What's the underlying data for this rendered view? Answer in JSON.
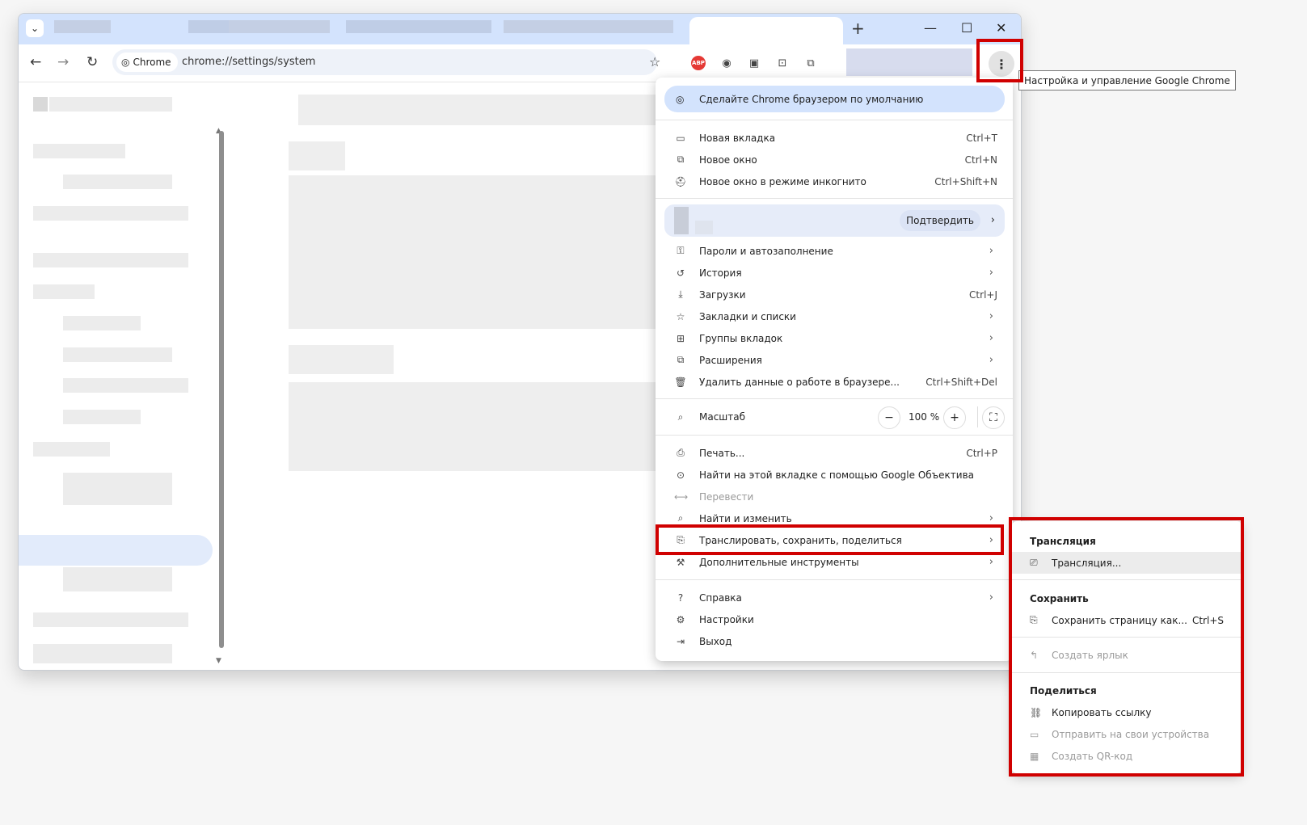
{
  "address": {
    "chip": "Chrome",
    "url": "chrome://settings/system"
  },
  "tooltip": "Настройка и управление Google Chrome",
  "menu": {
    "banner": "Сделайте Chrome браузером по умолчанию",
    "new_tab": {
      "label": "Новая вкладка",
      "shortcut": "Ctrl+T"
    },
    "new_window": {
      "label": "Новое окно",
      "shortcut": "Ctrl+N"
    },
    "incognito": {
      "label": "Новое окно в режиме инкогнито",
      "shortcut": "Ctrl+Shift+N"
    },
    "confirm": "Подтвердить",
    "passwords": "Пароли и автозаполнение",
    "history": "История",
    "downloads": {
      "label": "Загрузки",
      "shortcut": "Ctrl+J"
    },
    "bookmarks": "Закладки и списки",
    "tab_groups": "Группы вкладок",
    "extensions": "Расширения",
    "clear_data": {
      "label": "Удалить данные о работе в браузере...",
      "shortcut": "Ctrl+Shift+Del"
    },
    "zoom": {
      "label": "Масштаб",
      "value": "100 %"
    },
    "print": {
      "label": "Печать...",
      "shortcut": "Ctrl+P"
    },
    "lens": "Найти на этой вкладке с помощью Google Объектива",
    "translate": "Перевести",
    "find": "Найти и изменить",
    "cast_save_share": "Транслировать, сохранить, поделиться",
    "more_tools": "Дополнительные инструменты",
    "help": "Справка",
    "settings": "Настройки",
    "exit": "Выход"
  },
  "submenu": {
    "cast_header": "Трансляция",
    "cast_item": "Трансляция...",
    "save_header": "Сохранить",
    "save_page": {
      "label": "Сохранить страницу как...",
      "shortcut": "Ctrl+S"
    },
    "create_shortcut": "Создать ярлык",
    "share_header": "Поделиться",
    "copy_link": "Копировать ссылку",
    "send_devices": "Отправить на свои устройства",
    "qr": "Создать QR-код"
  }
}
